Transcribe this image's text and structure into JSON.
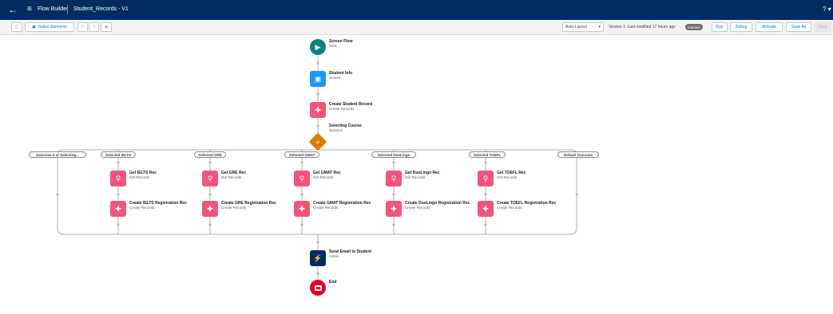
{
  "header": {
    "back_icon": "←",
    "app_icon": "flow-icon",
    "app_name": "Flow Builder",
    "flow_name": "Student_Records - V1",
    "help_icon": "? ▾"
  },
  "toolbar": {
    "select_elements_label": "Select Elements",
    "layout_select": "Auto-Layout",
    "version_text": "Version 1: Last modified 17 hours ago",
    "status_badge": "Inactive",
    "run_label": "Run",
    "debug_label": "Debug",
    "activate_label": "Activate",
    "save_as_label": "Save As",
    "save_label": "Save"
  },
  "colors": {
    "header_bg": "#032d60",
    "start": "#0b827c",
    "screen": "#1b96ff",
    "record": "#f2557a",
    "decision": "#dd7a01",
    "action": "#032d60",
    "end": "#ea001e"
  },
  "flow": {
    "start": {
      "title": "Screen Flow",
      "subtitle": "Start"
    },
    "screen": {
      "title": "Student Info",
      "subtitle": "Screen"
    },
    "create_student": {
      "title": "Create Student Record",
      "subtitle": "Create Records"
    },
    "decision": {
      "title": "Selecting Course",
      "subtitle": "Decision"
    },
    "outcomes": [
      "Outcome 6 of Selecting...",
      "Selected IELTS",
      "Selected GRE",
      "Selected GMAT",
      "Selected DuoLingo",
      "Selected TOEFL",
      "Default Outcome"
    ],
    "branches": [
      {
        "get_title": "Get IELTS Rec",
        "get_sub": "Get Records",
        "create_title": "Create IELTS Registration Rec",
        "create_sub": "Create Records"
      },
      {
        "get_title": "Get GRE Rec",
        "get_sub": "Get Records",
        "create_title": "Create GRE Registration Rec",
        "create_sub": "Create Records"
      },
      {
        "get_title": "Get GMAT Rec",
        "get_sub": "Get Records",
        "create_title": "Create GMAT Registration Rec",
        "create_sub": "Create Records"
      },
      {
        "get_title": "Get DuoLingo Rec",
        "get_sub": "Get Records",
        "create_title": "Create DuoLingo Registration Rec",
        "create_sub": "Create Records"
      },
      {
        "get_title": "Get TOEFL Rec",
        "get_sub": "Get Records",
        "create_title": "Create TOEFL Registration Rec",
        "create_sub": "Create Records"
      }
    ],
    "send_email": {
      "title": "Send Email to Student",
      "subtitle": "Action"
    },
    "end": {
      "title": "End"
    }
  }
}
